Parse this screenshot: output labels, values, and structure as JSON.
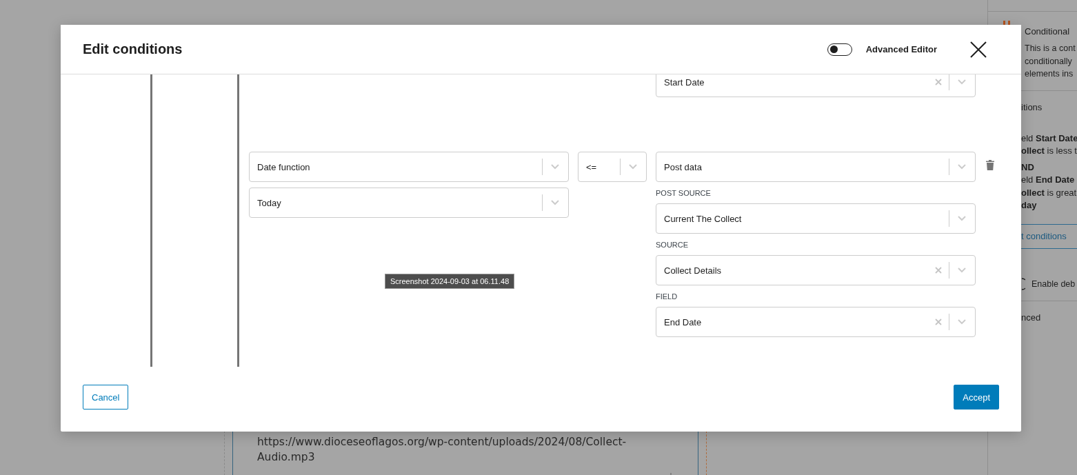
{
  "sidebar": {
    "block_title": "Conditional",
    "block_description": [
      "This is a cont",
      "conditionally",
      "elements ins"
    ],
    "panel_title": "itions",
    "rules": [
      [
        "eld **Start Date**",
        "**ollect** is less t"
      ],
      [
        "**ND**",
        "eld **End Date**",
        "**ollect** is great",
        "**day**"
      ]
    ],
    "edit_link": "t conditions",
    "debug_toggle": {
      "label": "Enable deb",
      "on": false
    },
    "advanced_title": "nced"
  },
  "content_block": {
    "url_lines": [
      "https://www.dioceseoflagos.org/wp-content/uploads/2024/08/Collect-",
      "Audio.mp3"
    ]
  },
  "modal": {
    "title": "Edit conditions",
    "advanced_editor": {
      "label": "Advanced Editor",
      "on": false
    },
    "conditions": [
      {
        "kind": "partial",
        "value_field": {
          "value": "Start Date",
          "clearable": true
        }
      },
      {
        "kind": "full",
        "left": [
          {
            "value": "Date function",
            "clearable": false
          },
          {
            "value": "Today",
            "clearable": false
          }
        ],
        "operator": {
          "value": "<=",
          "clearable": false
        },
        "right": [
          {
            "value": "Post data",
            "clearable": false
          },
          {
            "label": "POST SOURCE",
            "value": "Current The Collect",
            "clearable": false
          },
          {
            "label": "SOURCE",
            "value": "Collect Details",
            "clearable": true
          },
          {
            "label": "FIELD",
            "value": "End Date",
            "clearable": true
          }
        ]
      }
    ],
    "tooltip": "Screenshot 2024-09-03 at 06.11.48",
    "buttons": [
      {
        "label": "Cancel",
        "kind": "secondary"
      },
      {
        "label": "Accept",
        "kind": "primary"
      }
    ]
  }
}
